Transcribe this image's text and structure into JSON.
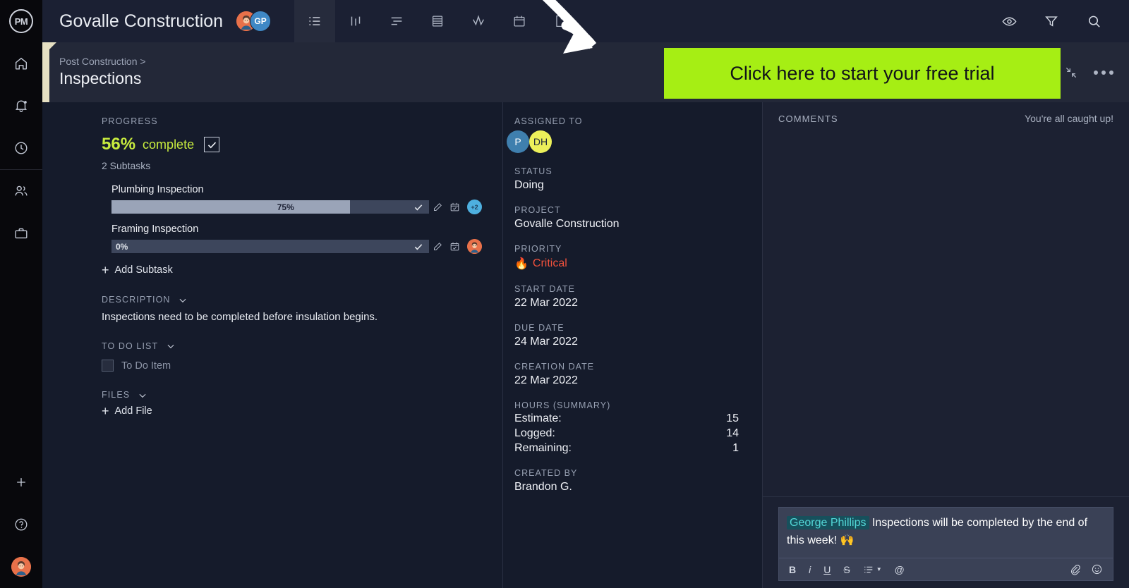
{
  "brand": {
    "logo_text": "PM"
  },
  "rail": {
    "items": [
      {
        "name": "home-icon",
        "label": "Home"
      },
      {
        "name": "bell-icon",
        "label": "Notifications"
      },
      {
        "name": "clock-icon",
        "label": "Timesheets"
      },
      {
        "name": "people-icon",
        "label": "Team"
      },
      {
        "name": "briefcase-icon",
        "label": "Projects"
      }
    ],
    "bottom": [
      {
        "name": "plus-icon",
        "label": "Add"
      },
      {
        "name": "help-icon",
        "label": "Help"
      },
      {
        "name": "user-avatar",
        "label": "Account"
      }
    ]
  },
  "topbar": {
    "title": "Govalle Construction",
    "avatars": [
      {
        "type": "face",
        "label": ""
      },
      {
        "type": "initials",
        "label": "GP"
      }
    ],
    "tabs": [
      {
        "name": "tab-list",
        "icon": "list-icon",
        "active": true
      },
      {
        "name": "tab-board",
        "icon": "board-icon",
        "active": false
      },
      {
        "name": "tab-gantt",
        "icon": "gantt-icon",
        "active": false
      },
      {
        "name": "tab-sheet",
        "icon": "sheet-icon",
        "active": false
      },
      {
        "name": "tab-workload",
        "icon": "activity-icon",
        "active": false
      },
      {
        "name": "tab-calendar",
        "icon": "calendar-icon",
        "active": false
      },
      {
        "name": "tab-docs",
        "icon": "document-icon",
        "active": false
      }
    ],
    "right_icons": [
      {
        "name": "eye-icon"
      },
      {
        "name": "filter-icon"
      },
      {
        "name": "search-icon"
      }
    ]
  },
  "subheader": {
    "breadcrumb": "Post Construction >",
    "title": "Inspections",
    "collapse_icon": "collapse-icon",
    "more_icon": "more-options-icon"
  },
  "cta": {
    "label": "Click here to start your free trial",
    "bg": "#a6ee14",
    "text_color": "#111319"
  },
  "progress": {
    "label": "PROGRESS",
    "percent_text": "56%",
    "complete_word": "complete",
    "accent_color": "#c8ec3e",
    "subtask_count": "2 Subtasks",
    "subtasks": [
      {
        "name": "Plumbing Inspection",
        "percent_text": "75%",
        "percent": 75,
        "avatar_type": "count",
        "avatar_label": "+2"
      },
      {
        "name": "Framing Inspection",
        "percent_text": "0%",
        "percent": 0,
        "avatar_type": "face",
        "avatar_label": ""
      }
    ],
    "add_subtask": "Add Subtask"
  },
  "description": {
    "label": "DESCRIPTION",
    "text": "Inspections need to be completed before insulation begins."
  },
  "todo": {
    "label": "TO DO LIST",
    "items": [
      {
        "text": "To Do Item",
        "checked": false
      }
    ]
  },
  "files": {
    "label": "FILES",
    "add_file": "Add File"
  },
  "details": {
    "assigned_label": "ASSIGNED TO",
    "assignees": [
      {
        "initials": "DH",
        "color": "#ecf05a"
      },
      {
        "initials": "P",
        "color": "#3f7fae"
      }
    ],
    "status_label": "STATUS",
    "status_value": "Doing",
    "project_label": "PROJECT",
    "project_value": "Govalle Construction",
    "priority_label": "PRIORITY",
    "priority_value": "Critical",
    "priority_color": "#f0513c",
    "start_date_label": "START DATE",
    "start_date_value": "22 Mar 2022",
    "due_date_label": "DUE DATE",
    "due_date_value": "24 Mar 2022",
    "creation_date_label": "CREATION DATE",
    "creation_date_value": "22 Mar 2022",
    "hours_label": "HOURS (SUMMARY)",
    "hours": [
      {
        "name": "Estimate:",
        "value": "15"
      },
      {
        "name": "Logged:",
        "value": "14"
      },
      {
        "name": "Remaining:",
        "value": "1"
      }
    ],
    "created_by_label": "CREATED BY",
    "created_by_value": "Brandon G."
  },
  "comments": {
    "title": "COMMENTS",
    "caught_up": "You're all caught up!",
    "composer": {
      "mention": "George Phillips",
      "text": " Inspections will be completed by the end of this week! 🙌",
      "toolbar": [
        {
          "name": "bold-button",
          "label": "B"
        },
        {
          "name": "italic-button",
          "label": "i"
        },
        {
          "name": "underline-button",
          "label": "U"
        },
        {
          "name": "strikethrough-button",
          "label": "S"
        },
        {
          "name": "list-button",
          "label": ""
        },
        {
          "name": "mention-button",
          "label": "@"
        }
      ],
      "attach_icon": "paperclip-icon",
      "emoji_icon": "emoji-icon"
    }
  }
}
